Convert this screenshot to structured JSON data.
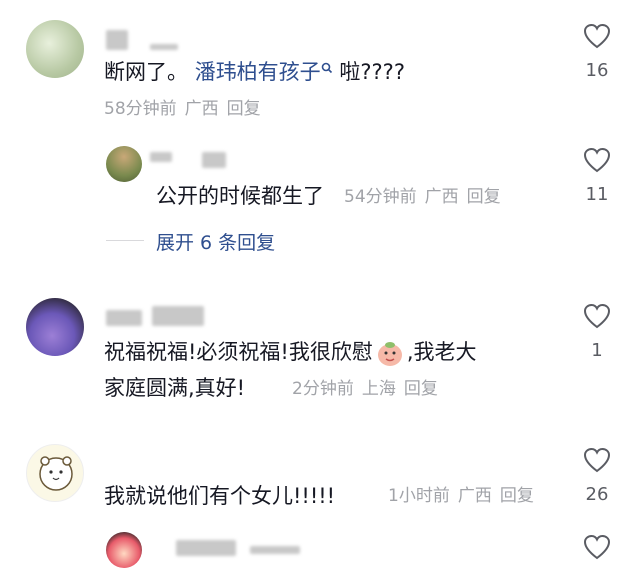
{
  "comments": [
    {
      "text_prefix": "断网了。",
      "mention": "潘玮柏有孩子",
      "search_icon": "search-icon",
      "text_suffix": "啦????",
      "time": "58分钟前",
      "location": "广西",
      "reply": "回复",
      "likes": "16",
      "replies": [
        {
          "text": "公开的时候都生了",
          "time": "54分钟前",
          "location": "广西",
          "reply": "回复",
          "likes": "11"
        }
      ],
      "expand_label": "展开 6 条回复"
    },
    {
      "text_line1": "祝福祝福!必须祝福!我很欣慰",
      "emoji": "peach-face-emoji",
      "text_line1_tail": ",我老大",
      "text_line2": "家庭圆满,真好!",
      "time": "2分钟前",
      "location": "上海",
      "reply": "回复",
      "likes": "1"
    },
    {
      "text": "我就说他们有个女儿!!!!!",
      "time": "1小时前",
      "location": "广西",
      "reply": "回复",
      "likes": "26"
    }
  ],
  "icons": {
    "like": "heart-icon"
  }
}
